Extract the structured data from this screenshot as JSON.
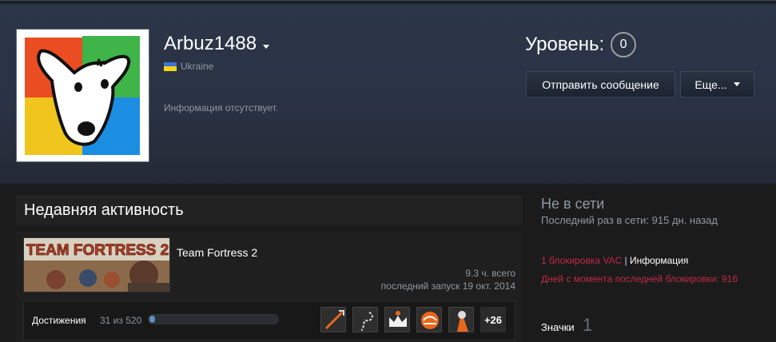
{
  "profile": {
    "persona_name": "Arbuz1488",
    "location": "Ukraine",
    "summary": "Информация отсутствует.",
    "level_label": "Уровень:",
    "level_value": "0"
  },
  "actions": {
    "send_message": "Отправить сообщение",
    "more": "Еще..."
  },
  "activity": {
    "title": "Недавняя активность",
    "game": {
      "name": "Team Fortress 2",
      "logo_text": "TEAM FORTRESS 2",
      "hours": "9.3 ч. всего",
      "last_played": "последний запуск 19 окт. 2014",
      "achievements_label": "Достижения",
      "achievements_count": "31 из 520",
      "achievements_progress": 0.06,
      "achievements_more": "+26"
    }
  },
  "sidebar": {
    "status": "Не в сети",
    "last_online": "Последний раз в сети: 915 дн. назад",
    "vac_ban": "1 блокировка VAC",
    "vac_separator": "|",
    "vac_info": "Информация",
    "days_since_ban": "Дней с момента последней блокировки: 916",
    "badges_label": "Значки",
    "badges_count": "1"
  },
  "colors": {
    "accent_red": "#c02942",
    "tf2_orange": "#e8671c"
  }
}
